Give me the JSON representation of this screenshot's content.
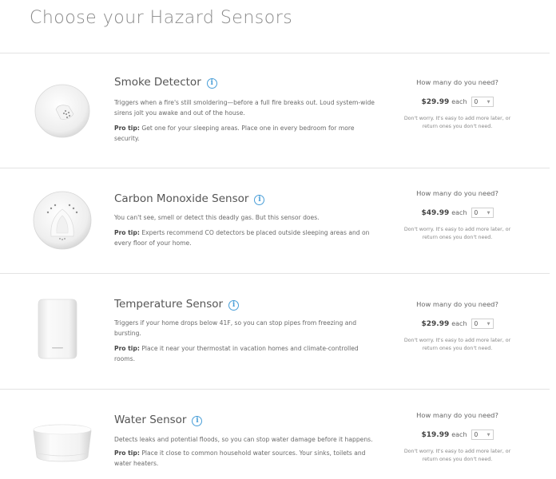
{
  "page": {
    "title": "Choose your Hazard Sensors"
  },
  "products": [
    {
      "name": "Smoke Detector",
      "description": "Triggers when a fire's still smoldering—before a full fire breaks out. Loud system-wide sirens jolt you awake and out of the house.",
      "tip_label": "Pro tip:",
      "tip": "Get one for your sleeping areas. Place one in every bedroom for more security.",
      "question": "How many do you need?",
      "price": "$29.99",
      "each": "each",
      "quantity": "0",
      "note": "Don't worry. It's easy to add more later, or return ones you don't need."
    },
    {
      "name": "Carbon Monoxide Sensor",
      "description": "You can't see, smell or detect this deadly gas. But this sensor does.",
      "tip_label": "Pro tip:",
      "tip": "Experts recommend CO detectors be placed outside sleeping areas and on every floor of your home.",
      "question": "How many do you need?",
      "price": "$49.99",
      "each": "each",
      "quantity": "0",
      "note": "Don't worry. It's easy to add more later, or return ones you don't need."
    },
    {
      "name": "Temperature Sensor",
      "description": "Triggers if your home drops below 41F, so you can stop pipes from freezing and bursting.",
      "tip_label": "Pro tip:",
      "tip": "Place it near your thermostat in vacation homes and climate-controlled rooms.",
      "question": "How many do you need?",
      "price": "$29.99",
      "each": "each",
      "quantity": "0",
      "note": "Don't worry. It's easy to add more later, or return ones you don't need."
    },
    {
      "name": "Water Sensor",
      "description": "Detects leaks and potential floods, so you can stop water damage before it happens.",
      "tip_label": "Pro tip:",
      "tip": "Place it close to common household water sources. Your sinks, toilets and water heaters.",
      "question": "How many do you need?",
      "price": "$19.99",
      "each": "each",
      "quantity": "0",
      "note": "Don't worry. It's easy to add more later, or return ones you don't need."
    }
  ],
  "icons": {
    "info": "info-circle-icon",
    "dropdown": "chevron-down-icon"
  },
  "colors": {
    "accent": "#4a9fd8"
  }
}
